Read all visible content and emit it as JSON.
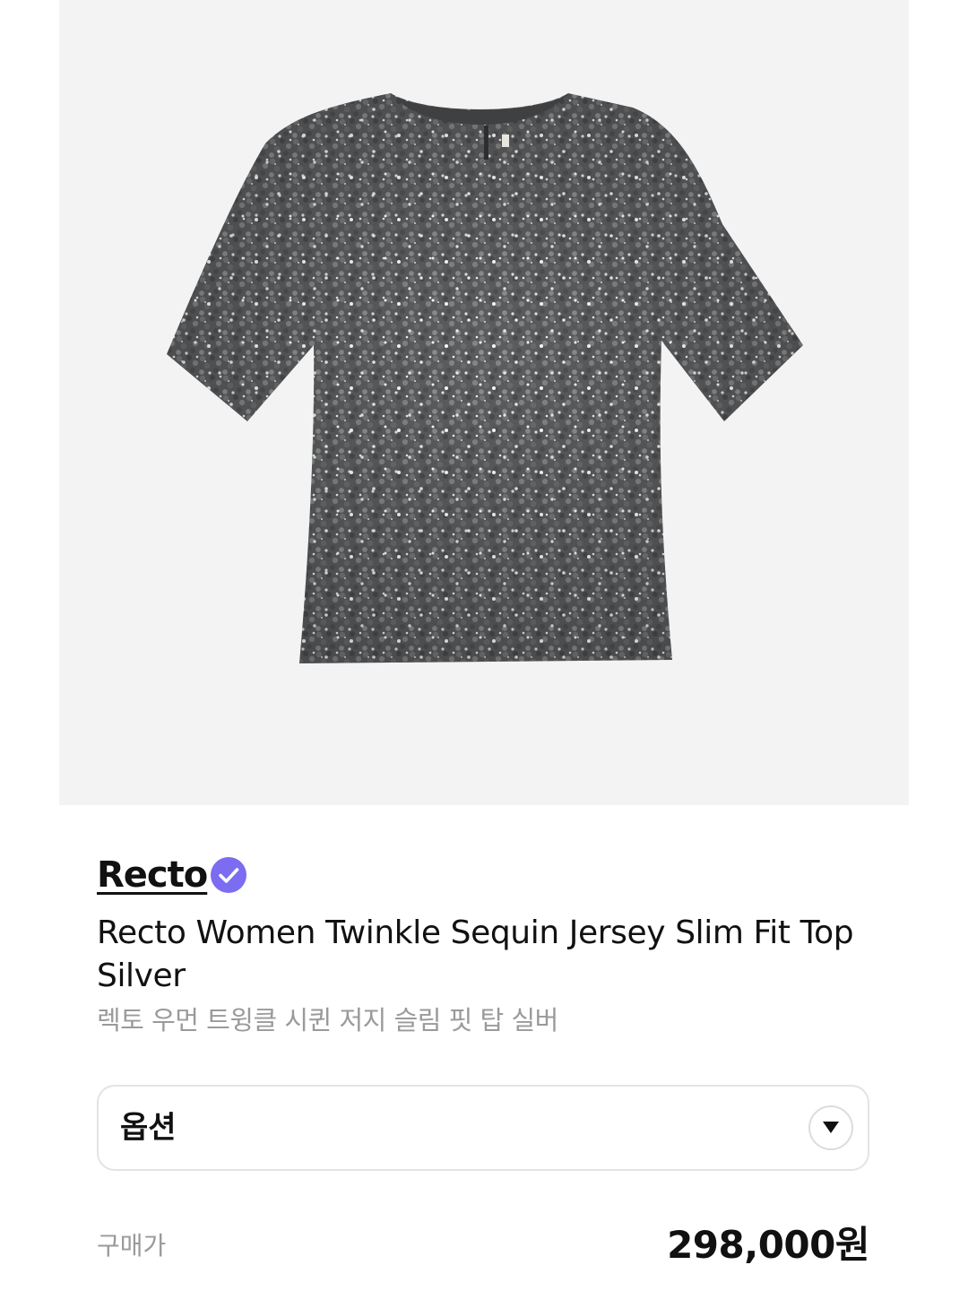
{
  "product": {
    "image_alt": "sequin-top-image",
    "brand": "Recto",
    "brand_verified": true,
    "title": "Recto Women Twinkle Sequin Jersey Slim Fit Top Silver",
    "subtitle": "렉토 우먼 트윙클 시퀸 저지 슬림 핏 탑 실버"
  },
  "option": {
    "label": "옵션",
    "icon": "chevron-down-icon"
  },
  "price": {
    "label": "구매가",
    "value": "298,000원"
  },
  "colors": {
    "image_background": "#f3f3f3",
    "verified_badge": "#7b6cf2",
    "text_primary": "#111111",
    "text_secondary": "#9a9a9a",
    "border": "#e3e3e3"
  }
}
